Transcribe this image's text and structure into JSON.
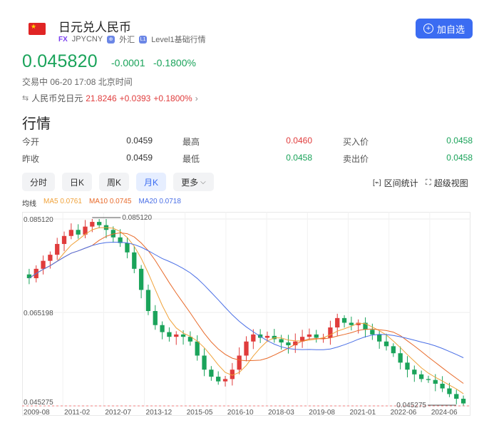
{
  "header": {
    "title": "日元兑人民币",
    "fx_tag": "FX",
    "symbol": "JPYCNY",
    "market": "外汇",
    "level_icon": "L1",
    "level": "Level1基础行情",
    "add_button": "加自选",
    "flag_icon": "china-flag-icon"
  },
  "quote": {
    "price": "0.045820",
    "change": "-0.0001",
    "change_pct": "-0.1800%",
    "status": "交易中 06-20 17:08 北京时间",
    "reverse_label": "人民币兑日元",
    "reverse_price": "21.8246",
    "reverse_change": "+0.0393",
    "reverse_pct": "+0.1800%"
  },
  "section_title": "行情",
  "stats": {
    "open_label": "今开",
    "open": "0.0459",
    "high_label": "最高",
    "high": "0.0460",
    "bid_label": "买入价",
    "bid": "0.0458",
    "prev_label": "昨收",
    "prev": "0.0459",
    "low_label": "最低",
    "low": "0.0458",
    "ask_label": "卖出价",
    "ask": "0.0458"
  },
  "tabs": [
    "分时",
    "日K",
    "周K",
    "月K",
    "更多"
  ],
  "active_tab": "月K",
  "tools": {
    "range": "区间统计",
    "super": "超级视图"
  },
  "ma": {
    "label": "均线",
    "ma5": "MA5 0.0761",
    "ma10": "MA10 0.0745",
    "ma20": "MA20 0.0718"
  },
  "colors": {
    "up": "#e03c3c",
    "down": "#1aa35a",
    "accent": "#3b6cf2",
    "ma5": "#f0a23a",
    "ma10": "#e86a2a",
    "ma20": "#4a6fe6"
  },
  "chart_data": {
    "type": "candlestick",
    "y_ticks": [
      "0.085120",
      "0.065198",
      "0.045275"
    ],
    "x_ticks": [
      "2009-08",
      "2011-02",
      "2012-07",
      "2013-12",
      "2015-05",
      "2016-10",
      "2018-03",
      "2019-08",
      "2021-01",
      "2022-06",
      "2024-06"
    ],
    "max_label": "0.085120",
    "min_label": "0.045275",
    "ylim": [
      0.045275,
      0.08512
    ],
    "close_series": [
      0.0725,
      0.0745,
      0.0762,
      0.0775,
      0.0798,
      0.0815,
      0.0828,
      0.0818,
      0.0835,
      0.0845,
      0.0838,
      0.0828,
      0.0812,
      0.08,
      0.078,
      0.0745,
      0.07,
      0.0655,
      0.0625,
      0.061,
      0.06,
      0.0605,
      0.06,
      0.059,
      0.056,
      0.053,
      0.0515,
      0.0505,
      0.051,
      0.053,
      0.056,
      0.059,
      0.0605,
      0.0598,
      0.0602,
      0.0595,
      0.0588,
      0.0582,
      0.059,
      0.06,
      0.0605,
      0.0598,
      0.0598,
      0.062,
      0.064,
      0.063,
      0.0625,
      0.063,
      0.0615,
      0.0605,
      0.059,
      0.058,
      0.0565,
      0.0545,
      0.053,
      0.052,
      0.051,
      0.0508,
      0.05,
      0.049,
      0.0478,
      0.0468,
      0.0458
    ],
    "close_series_unit": "CNY per JPY (approx. monthly closes)"
  }
}
